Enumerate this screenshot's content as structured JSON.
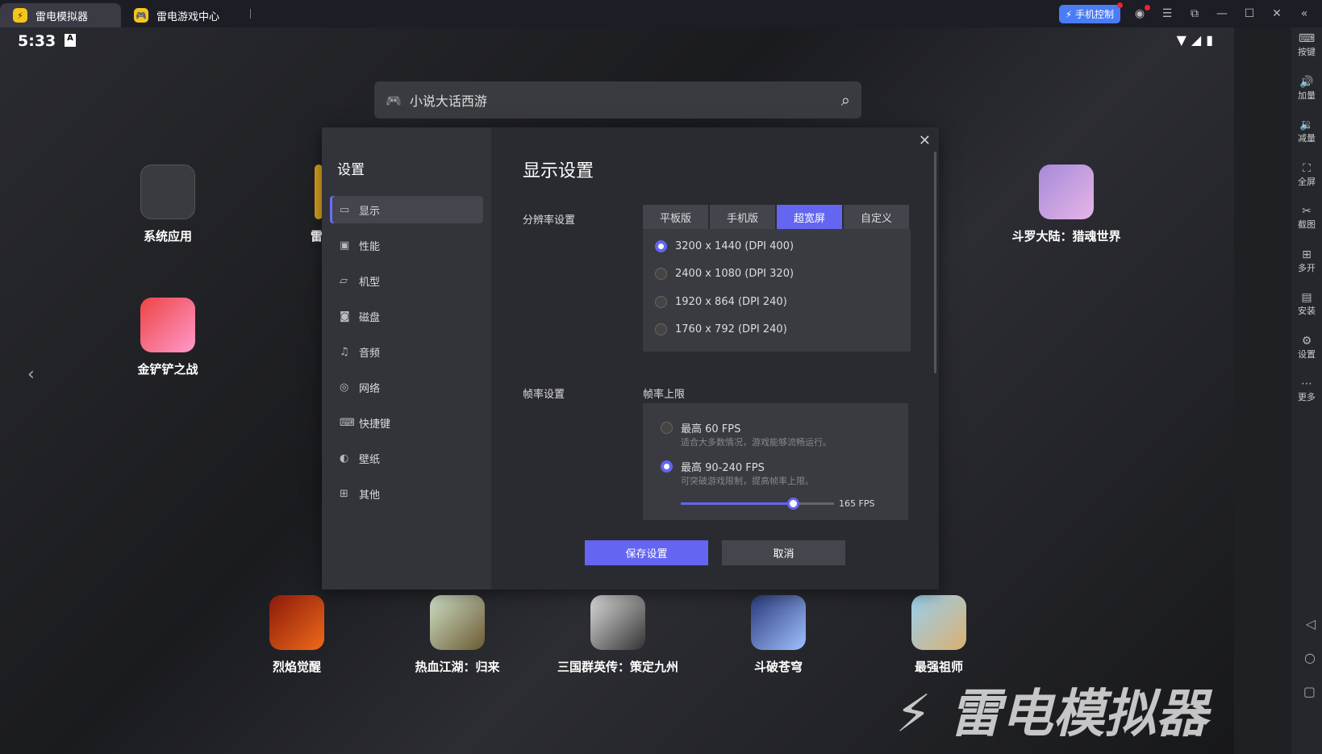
{
  "tabs": [
    {
      "label": "雷电模拟器",
      "icon": "ld-logo-icon"
    },
    {
      "label": "雷电游戏中心",
      "icon": "gamepad-icon"
    }
  ],
  "titlebar": {
    "phone_control": "手机控制"
  },
  "status": {
    "time": "5:33"
  },
  "search": {
    "placeholder": "小说大话西游"
  },
  "apps": [
    {
      "label": "系统应用"
    },
    {
      "label": "雷"
    },
    {
      "label": "斗罗大陆：猎魂世界"
    },
    {
      "label": "金铲铲之战"
    },
    {
      "label": "烈焰觉醒"
    },
    {
      "label": "热血江湖：归来"
    },
    {
      "label": "三国群英传：策定九州"
    },
    {
      "label": "斗破苍穹"
    },
    {
      "label": "最强祖师"
    }
  ],
  "sidebar": [
    "按键",
    "加量",
    "减量",
    "全屏",
    "截图",
    "多开",
    "安装",
    "设置",
    "更多"
  ],
  "settings": {
    "title": "设置",
    "menu": [
      "显示",
      "性能",
      "机型",
      "磁盘",
      "音频",
      "网络",
      "快捷键",
      "壁纸",
      "其他"
    ],
    "heading": "显示设置",
    "resolution_label": "分辨率设置",
    "modes": [
      "平板版",
      "手机版",
      "超宽屏",
      "自定义"
    ],
    "selected_mode": "超宽屏",
    "resolutions": [
      "3200 x 1440  (DPI 400)",
      "2400 x 1080  (DPI 320)",
      "1920 x 864  (DPI 240)",
      "1760 x 792  (DPI 240)"
    ],
    "fps_label": "帧率设置",
    "fps_sub": "帧率上限",
    "fps_options": [
      {
        "title": "最高 60 FPS",
        "hint": "适合大多数情况，游戏能够流畅运行。"
      },
      {
        "title": "最高 90-240 FPS",
        "hint": "可突破游戏限制，提高帧率上限。"
      }
    ],
    "fps_value": "165 FPS",
    "slider_fraction": 0.73,
    "save": "保存设置",
    "cancel": "取消"
  },
  "watermark": "雷电模拟器"
}
